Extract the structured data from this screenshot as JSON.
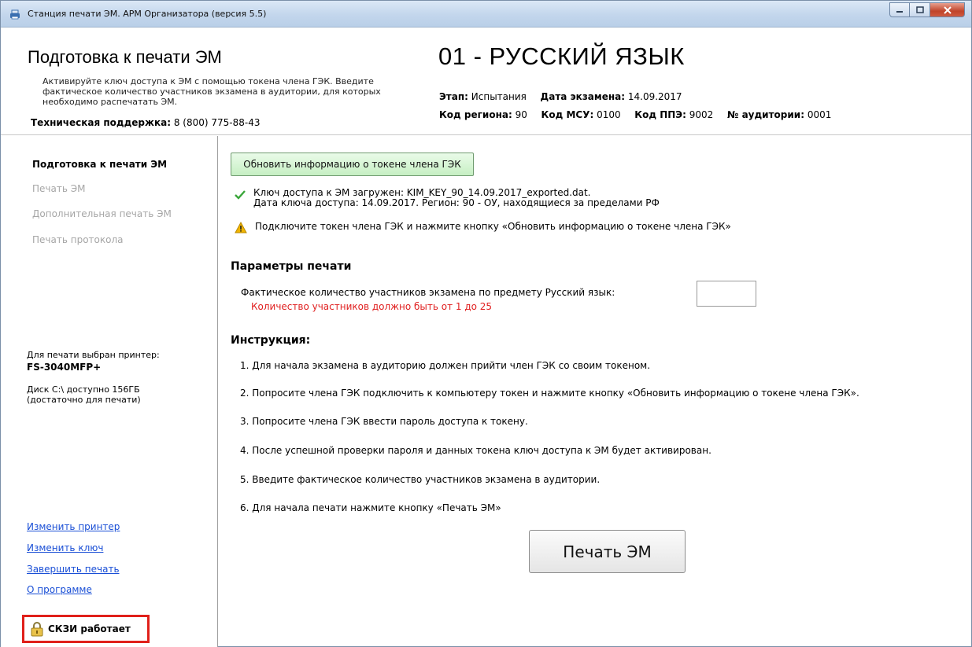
{
  "window": {
    "title": "Станция печати ЭМ. АРМ Организатора (версия 5.5)"
  },
  "header": {
    "title": "Подготовка к печати ЭМ",
    "description": "Активируйте ключ доступа к ЭМ с помощью токена члена ГЭК. Введите фактическое количество участников экзамена в аудитории, для которых необходимо распечатать ЭМ.",
    "support_label": "Техническая поддержка:",
    "support_phone": "8 (800) 775-88-43",
    "subject": "01 - РУССКИЙ ЯЗЫК",
    "stage_label": "Этап:",
    "stage_value": "Испытания",
    "date_label": "Дата экзамена:",
    "date_value": "14.09.2017",
    "region_label": "Код региона:",
    "region_value": "90",
    "msu_label": "Код МСУ:",
    "msu_value": "0100",
    "ppe_label": "Код ППЭ:",
    "ppe_value": "9002",
    "room_label": "№ аудитории:",
    "room_value": "0001"
  },
  "sidebar": {
    "nav": [
      {
        "label": "Подготовка к печати ЭМ"
      },
      {
        "label": "Печать ЭМ"
      },
      {
        "label": "Дополнительная печать ЭМ"
      },
      {
        "label": "Печать протокола"
      }
    ],
    "printer_label": "Для печати выбран принтер:",
    "printer_name": "FS-3040MFP+",
    "disk_line1": "Диск C:\\ доступно 156ГБ",
    "disk_line2": "(достаточно для печати)",
    "links": [
      {
        "label": "Изменить принтер"
      },
      {
        "label": "Изменить ключ"
      },
      {
        "label": "Завершить печать"
      },
      {
        "label": "О программе"
      }
    ],
    "skzi_status": "СКЗИ работает"
  },
  "main": {
    "refresh_button": "Обновить информацию о токене члена ГЭК",
    "key_loaded_line1": "Ключ доступа к ЭМ загружен: KIM_KEY_90_14.09.2017_exported.dat.",
    "key_loaded_line2": "Дата ключа доступа: 14.09.2017. Регион: 90 - ОУ, находящиеся за пределами РФ",
    "token_warning": "Подключите токен члена ГЭК и нажмите кнопку «Обновить информацию о токене члена ГЭК»",
    "params_title": "Параметры печати",
    "participants_label": "Фактическое количество участников экзамена по предмету Русский язык:",
    "participants_value": "",
    "participants_error": "Количество участников должно быть от 1 до 25",
    "instructions_title": "Инструкция:",
    "instructions": [
      "1. Для начала экзамена в аудиторию должен прийти член ГЭК со своим токеном.",
      "2. Попросите члена ГЭК подключить к компьютеру токен и нажмите кнопку «Обновить информацию о токене члена ГЭК».",
      "3. Попросите члена ГЭК ввести пароль доступа к токену.",
      "4. После успешной проверки пароля и данных токена ключ доступа к ЭМ будет активирован.",
      "5. Введите фактическое количество участников экзамена в аудитории.",
      "6. Для начала печати нажмите кнопку «Печать ЭМ»"
    ],
    "print_button": "Печать ЭМ"
  },
  "colors": {
    "error": "#e02020",
    "link": "#1a4fd6",
    "highlight_frame": "#e0201a",
    "check": "#3aa63a",
    "warning": "#f0b400"
  }
}
